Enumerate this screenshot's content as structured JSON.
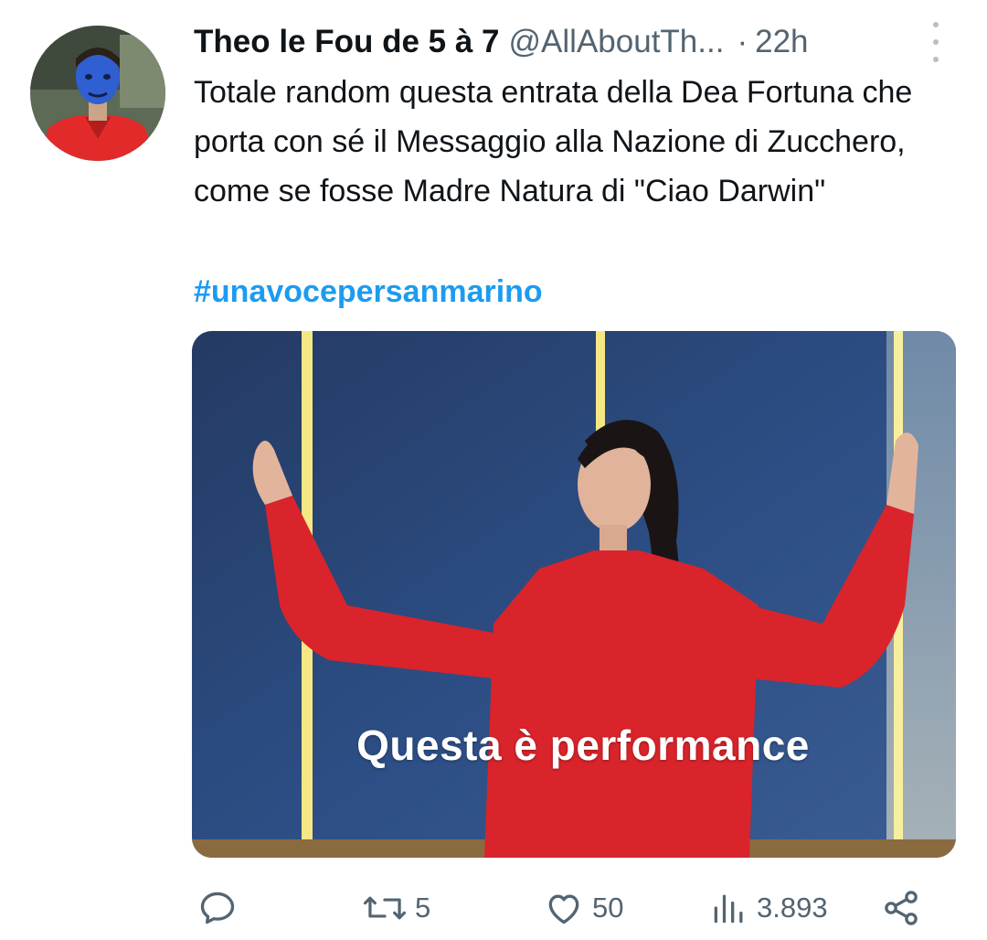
{
  "tweet": {
    "display_name": "Theo le Fou de 5 à 7",
    "handle": "@AllAboutTh...",
    "separator": "·",
    "time": "22h",
    "text": "Totale random questa entrata della Dea Fortuna che porta con sé il Messaggio alla Nazione di Zucchero, come se fosse Madre Natura di \"Ciao Darwin\"",
    "hashtag": "#unavocepersanmarino",
    "media_caption": "Questa è performance"
  },
  "actions": {
    "reply_count": "",
    "retweet_count": "5",
    "like_count": "50",
    "views_count": "3.893"
  },
  "icons": [
    "reply-icon",
    "retweet-icon",
    "like-icon",
    "views-icon",
    "share-icon",
    "more-options-icon"
  ],
  "colors": {
    "text": "#0f1419",
    "secondary": "#536471",
    "hashtag": "#1d9bf0",
    "dress_red": "#d9242b",
    "background": "#ffffff"
  }
}
